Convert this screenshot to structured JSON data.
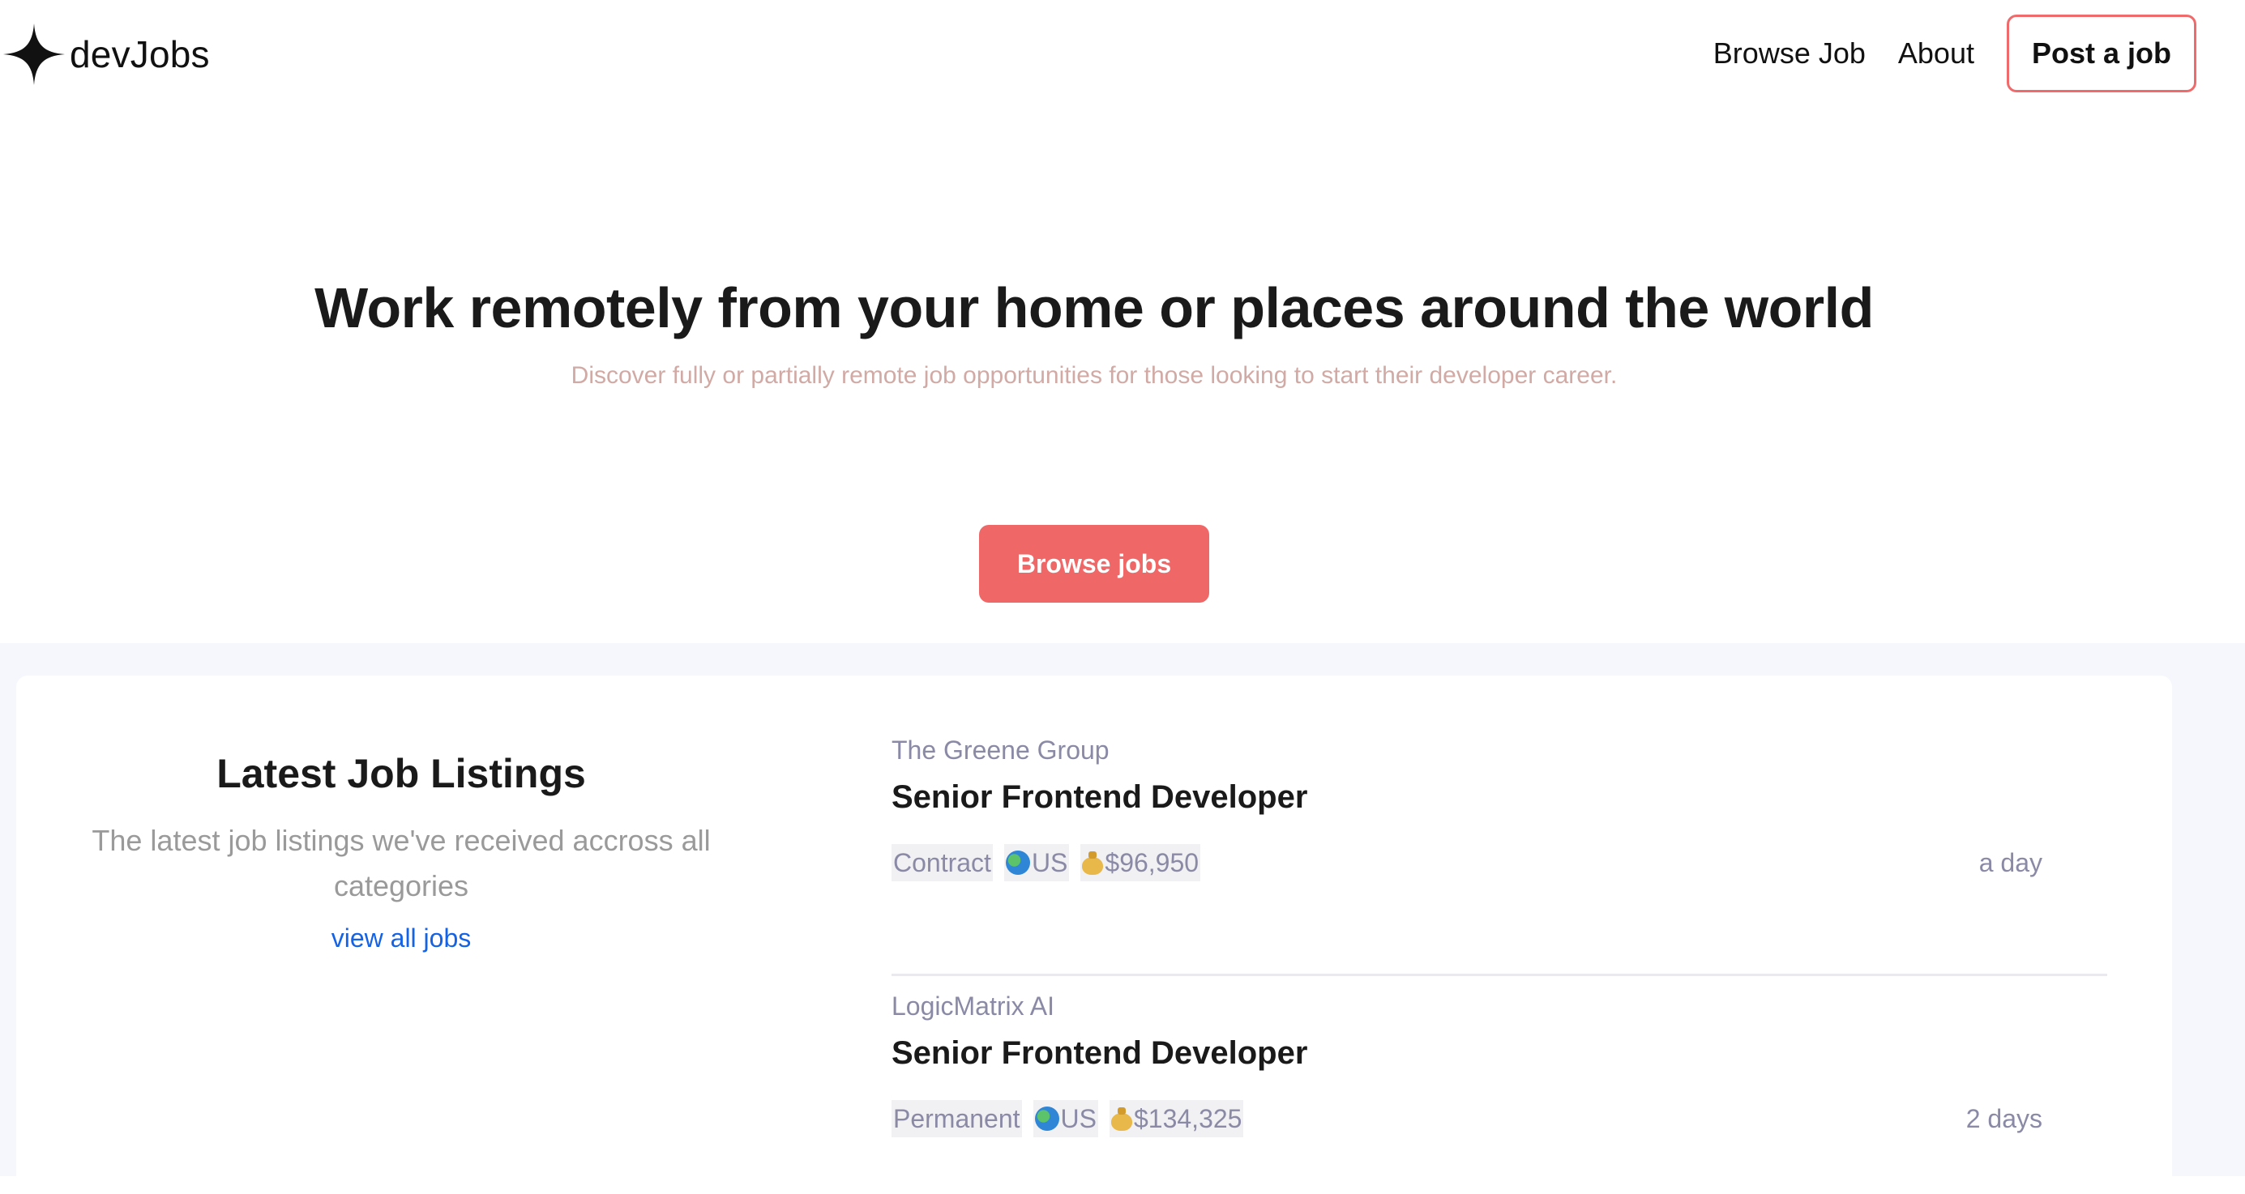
{
  "header": {
    "logo_text": "devJobs",
    "nav": {
      "browse_job": "Browse Job",
      "about": "About",
      "post_job": "Post a job"
    }
  },
  "hero": {
    "title": "Work remotely from your home or places around the world",
    "subtitle": "Discover fully or partially remote job opportunities for those looking to start their developer career.",
    "button": "Browse jobs"
  },
  "listings": {
    "title": "Latest Job Listings",
    "description": "The latest job listings we've received accross all categories",
    "view_all": "view all jobs",
    "jobs": [
      {
        "company": "The Greene Group",
        "title": "Senior Frontend Developer",
        "type": "Contract",
        "location": "US",
        "salary": "$96,950",
        "posted": "a day"
      },
      {
        "company": "LogicMatrix AI",
        "title": "Senior Frontend Developer",
        "type": "Permanent",
        "location": "US",
        "salary": "$134,325",
        "posted": "2 days"
      }
    ]
  },
  "colors": {
    "accent": "#f06767",
    "link": "#1463e6",
    "muted": "#8a8aa6",
    "section_bg": "#f5f7fc"
  },
  "icons": {
    "logo": "sparkle-icon",
    "location": "globe-icon",
    "salary": "money-bag-icon"
  }
}
